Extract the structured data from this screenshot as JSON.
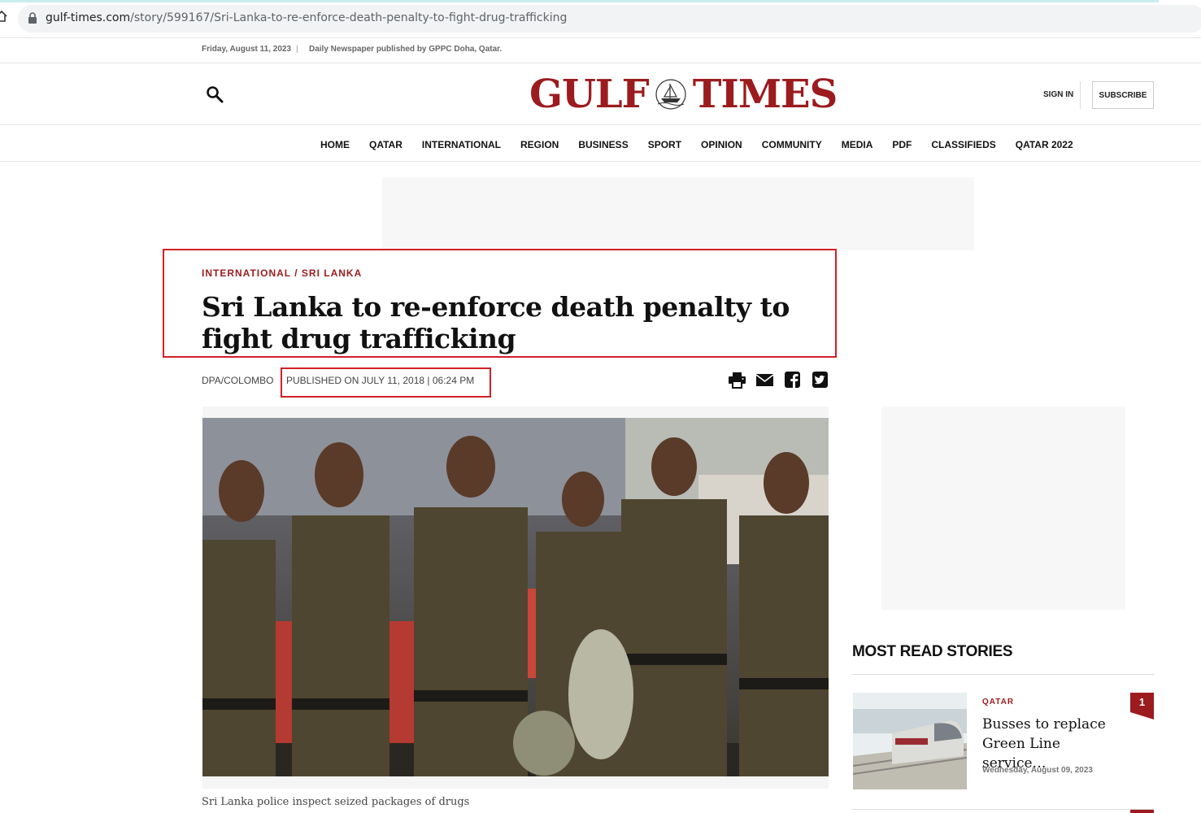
{
  "browser": {
    "url_host": "gulf-times.com",
    "url_path": "/story/599167/Sri-Lanka-to-re-enforce-death-penalty-to-fight-drug-trafficking"
  },
  "topbar": {
    "date": "Friday, August 11, 2023",
    "separator": "|",
    "tagline": "Daily Newspaper published by GPPC Doha, Qatar."
  },
  "masthead": {
    "logo_left": "GULF",
    "logo_right": "TIMES",
    "signin": "SIGN IN",
    "subscribe": "SUBSCRIBE"
  },
  "nav": {
    "items": [
      "HOME",
      "QATAR",
      "INTERNATIONAL",
      "REGION",
      "BUSINESS",
      "SPORT",
      "OPINION",
      "COMMUNITY",
      "MEDIA",
      "PDF",
      "CLASSIFIEDS",
      "QATAR 2022"
    ]
  },
  "article": {
    "category_primary": "INTERNATIONAL",
    "category_sep": " / ",
    "category_secondary": "SRI LANKA",
    "headline": "Sri Lanka to re-enforce death penalty to fight drug trafficking",
    "byline": "DPA/COLOMBO",
    "published": "PUBLISHED ON JULY 11, 2018 | 06:24 PM",
    "caption": "Sri Lanka police inspect seized packages of drugs"
  },
  "share_icons": [
    "print-icon",
    "email-icon",
    "facebook-icon",
    "twitter-icon"
  ],
  "most_read": {
    "title": "MOST READ STORIES",
    "items": [
      {
        "rank": "1",
        "category": "QATAR",
        "headline": "Busses to replace Green Line service…",
        "date": "Wednesday, August 09, 2023"
      }
    ]
  },
  "colors": {
    "brand": "#9b1b1e",
    "highlight": "#d32027"
  }
}
